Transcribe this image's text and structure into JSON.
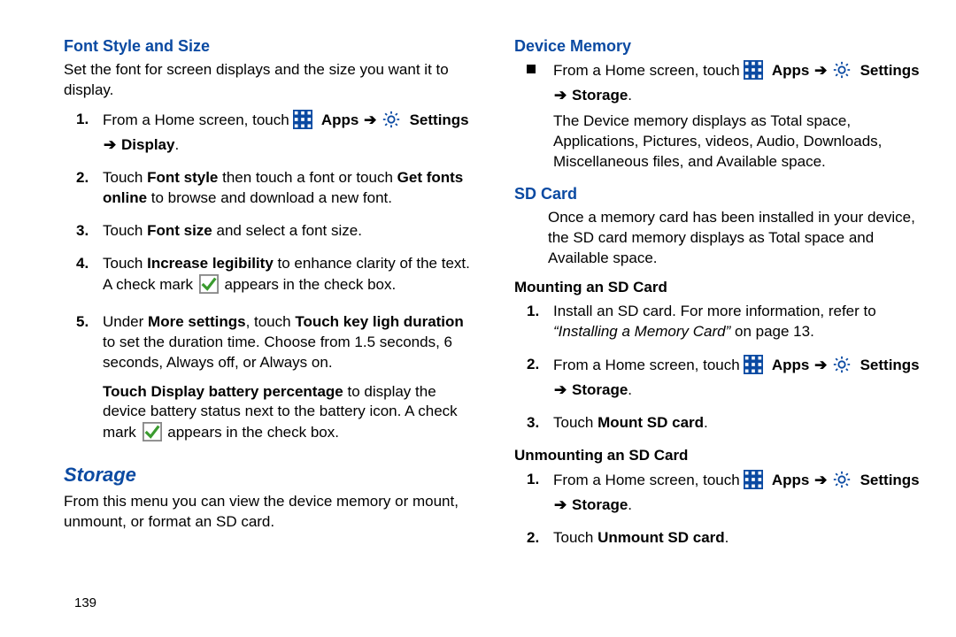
{
  "page_number": "139",
  "arrow": "➔",
  "left": {
    "h_font": "Font Style and Size",
    "font_intro": "Set the font for screen displays and the size you want it to display.",
    "step1_a": "From a Home screen, touch ",
    "apps": "Apps",
    "settings": "Settings",
    "display": "Display",
    "step2_a": "Touch ",
    "step2_fontstyle": "Font style",
    "step2_b": " then touch a font or touch ",
    "step2_getfonts": "Get fonts online",
    "step2_c": " to browse and download a new font.",
    "step3_a": "Touch ",
    "step3_fontsize": "Font size",
    "step3_b": " and select a font size.",
    "step4_a": "Touch ",
    "step4_inc": "Increase legibility",
    "step4_b": " to enhance clarity of the text. A check mark ",
    "step4_c": " appears in the check box.",
    "step5_a": "Under ",
    "step5_more": "More settings",
    "step5_b": ", touch ",
    "step5_touchkey": "Touch key ligh duration",
    "step5_c": " to set the duration time. Choose from 1.5 seconds, 6 seconds, Always off, or Always on.",
    "step5_batt": "Touch Display battery percentage",
    "step5_d": " to display the device battery status next to the battery icon. A check mark ",
    "step5_e": " appears in the check box.",
    "h_storage": "Storage",
    "storage_intro": "From this menu you can view the device memory or mount, unmount, or format an SD card."
  },
  "right": {
    "h_devmem": "Device Memory",
    "dm_a": "From a Home screen, touch ",
    "apps": "Apps",
    "settings": "Settings",
    "storage": "Storage",
    "dm_desc": "The Device memory displays as Total space, Applications, Pictures, videos, Audio, Downloads, Miscellaneous files, and Available space.",
    "h_sd": "SD Card",
    "sd_intro": "Once a memory card has been installed in your device, the SD card memory displays as Total space and Available space.",
    "h_mount": "Mounting an SD Card",
    "m1_a": "Install an SD card. For more information, refer to ",
    "m1_ref": "“Installing a Memory Card”",
    "m1_b": " on page 13.",
    "m2_a": "From a Home screen, touch ",
    "m3_a": "Touch ",
    "m3_b": "Mount SD card",
    "h_unmount": "Unmounting an SD Card",
    "u1_a": "From a Home screen, touch ",
    "u2_a": "Touch ",
    "u2_b": "Unmount SD card"
  }
}
